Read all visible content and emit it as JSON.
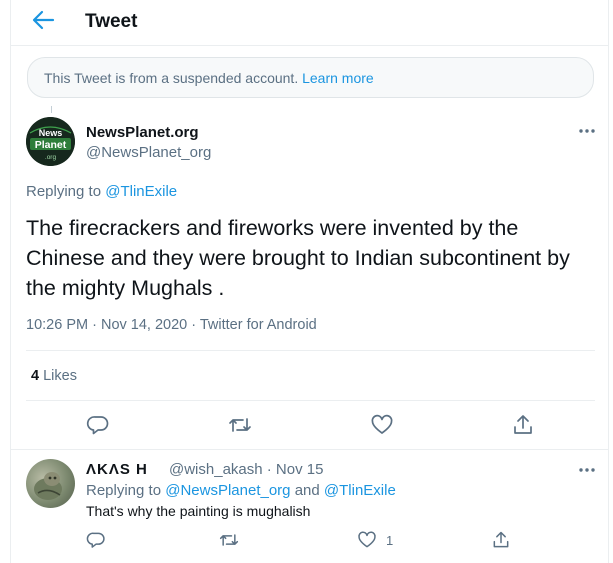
{
  "header": {
    "title": "Tweet"
  },
  "notice": {
    "text": "This Tweet is from a suspended account.",
    "link": "Learn more"
  },
  "tweet": {
    "author_name": "NewsPlanet.org",
    "author_handle": "@NewsPlanet_org",
    "avatar_lines": [
      "News",
      "Planet",
      ".org"
    ],
    "replying_prefix": "Replying to",
    "replying_mention": "@TlinExile",
    "text": "The firecrackers and fireworks were invented by the Chinese and they were brought to Indian subcontinent by the mighty Mughals .",
    "time": "10:26 PM",
    "date": "Nov 14, 2020",
    "source": "Twitter for Android",
    "likes_count": "4",
    "likes_label": "Likes"
  },
  "reply": {
    "author_name": "ΛKΛS H",
    "author_handle": "@wish_akash · Nov 15",
    "replying_prefix": "Replying to",
    "mention_1": "@NewsPlanet_org",
    "and_word": "and",
    "mention_2": "@TlinExile",
    "text": "That's why the painting is mughalish",
    "like_count": "1"
  },
  "icons": {
    "back": "arrow-left-icon",
    "more": "more-horizontal-icon",
    "reply": "comment-icon",
    "retweet": "retweet-icon",
    "like": "heart-icon",
    "share": "share-icon"
  },
  "colors": {
    "accent": "#1b95e0",
    "secondary_text": "#5b7083",
    "primary_text": "#0f1419",
    "border": "#ebeef0",
    "notice_bg": "#f7f9fa"
  }
}
